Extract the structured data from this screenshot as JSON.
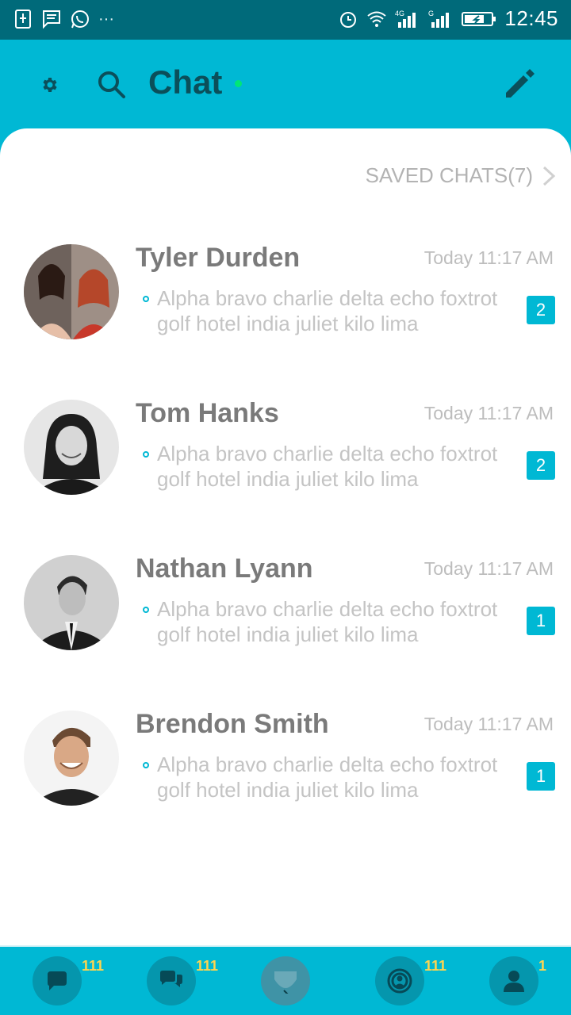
{
  "status_bar": {
    "time": "12:45",
    "overflow_indicator": "···",
    "icons": [
      "usb-icon",
      "message-icon",
      "whatsapp-icon",
      "alarm-icon",
      "wifi-icon",
      "signal-4g-icon",
      "signal-g-icon",
      "battery-icon"
    ]
  },
  "header": {
    "title": "Chat",
    "online_dot_color": "#00E676",
    "icons": [
      "gear-icon",
      "search-icon",
      "compose-icon"
    ]
  },
  "saved_chats": {
    "label": "SAVED CHATS(7)"
  },
  "chats": [
    {
      "name": "Tyler Durden",
      "time": "Today 11:17 AM",
      "message": "Alpha bravo charlie delta echo foxtrot golf hotel india juliet kilo lima",
      "unread": "2"
    },
    {
      "name": "Tom Hanks",
      "time": "Today 11:17 AM",
      "message": "Alpha bravo charlie delta echo foxtrot golf hotel india juliet kilo lima",
      "unread": "2"
    },
    {
      "name": "Nathan Lyann",
      "time": "Today 11:17 AM",
      "message": "Alpha bravo charlie delta echo foxtrot golf hotel india juliet kilo lima",
      "unread": "1"
    },
    {
      "name": "Brendon Smith",
      "time": "Today 11:17 AM",
      "message": "Alpha bravo charlie delta echo foxtrot golf hotel india juliet kilo lima",
      "unread": "1"
    }
  ],
  "bottom_nav": [
    {
      "icon": "chat-bubble-icon",
      "badge": "111"
    },
    {
      "icon": "group-chat-icon",
      "badge": "111"
    },
    {
      "icon": "center-action-icon",
      "badge": ""
    },
    {
      "icon": "broadcast-icon",
      "badge": "111"
    },
    {
      "icon": "profile-icon",
      "badge": "1"
    }
  ],
  "colors": {
    "accent": "#00B8D4",
    "status_bar": "#006A7A",
    "title": "#0B4F5A",
    "badge": "#FFD54F"
  }
}
